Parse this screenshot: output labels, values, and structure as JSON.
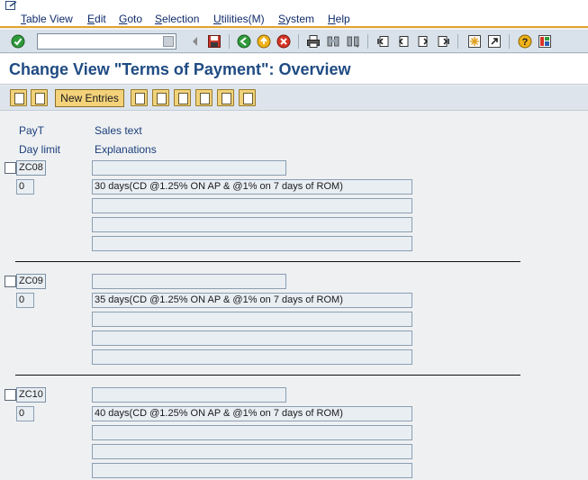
{
  "menu": {
    "items": [
      "Table View",
      "Edit",
      "Goto",
      "Selection",
      "Utilities(M)",
      "System",
      "Help"
    ]
  },
  "toolbar": {
    "command_field_value": "",
    "icons": [
      "enter-check-icon",
      "back-arrow-icon",
      "save-icon",
      "back-icon",
      "exit-icon",
      "cancel-icon",
      "print-icon",
      "find-icon",
      "find-next-icon",
      "first-page-icon",
      "previous-page-icon",
      "next-page-icon",
      "last-page-icon",
      "create-session-icon",
      "shortcut-icon",
      "help-icon",
      "customize-layout-icon"
    ]
  },
  "title": "Change View \"Terms of Payment\": Overview",
  "app_toolbar": {
    "new_entries_label": "New Entries",
    "icons": [
      "display-change-icon",
      "details-icon",
      "copy-as-icon",
      "delete-icon",
      "undo-change-icon",
      "select-all-icon",
      "select-block-icon",
      "deselect-all-icon"
    ]
  },
  "columns": {
    "payt": "PayT",
    "sales_text": "Sales text",
    "day_limit": "Day limit",
    "explanations": "Explanations"
  },
  "records": [
    {
      "payt": "ZC08",
      "day_limit": "0",
      "sales_text": "",
      "explanations": [
        "30 days(CD @1.25% ON AP & @1% on 7 days of ROM)",
        "",
        "",
        ""
      ]
    },
    {
      "payt": "ZC09",
      "day_limit": "0",
      "sales_text": "",
      "explanations": [
        "35 days(CD @1.25% ON AP & @1% on 7 days of ROM)",
        "",
        "",
        ""
      ]
    },
    {
      "payt": "ZC10",
      "day_limit": "0",
      "sales_text": "",
      "explanations": [
        "40 days(CD @1.25% ON AP & @1% on 7 days of ROM)",
        "",
        "",
        ""
      ]
    }
  ]
}
